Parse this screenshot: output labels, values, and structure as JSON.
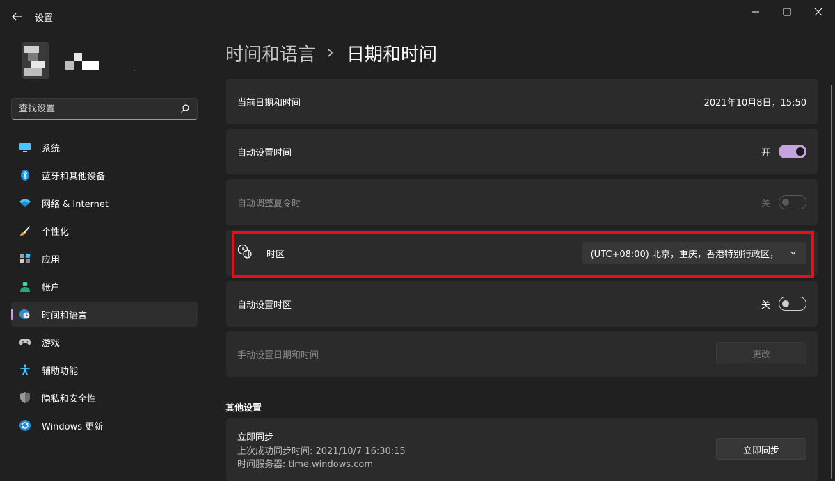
{
  "window": {
    "title": "设置"
  },
  "sidebar": {
    "search_placeholder": "查找设置",
    "items": [
      {
        "label": "系统",
        "icon": "monitor-icon"
      },
      {
        "label": "蓝牙和其他设备",
        "icon": "bluetooth-icon"
      },
      {
        "label": "网络 & Internet",
        "icon": "wifi-icon"
      },
      {
        "label": "个性化",
        "icon": "brush-icon"
      },
      {
        "label": "应用",
        "icon": "apps-icon"
      },
      {
        "label": "帐户",
        "icon": "person-icon"
      },
      {
        "label": "时间和语言",
        "icon": "globe-clock-icon",
        "active": true
      },
      {
        "label": "游戏",
        "icon": "gamepad-icon"
      },
      {
        "label": "辅助功能",
        "icon": "accessibility-icon"
      },
      {
        "label": "隐私和安全性",
        "icon": "shield-icon"
      },
      {
        "label": "Windows 更新",
        "icon": "update-icon"
      }
    ]
  },
  "breadcrumb": {
    "parent": "时间和语言",
    "current": "日期和时间"
  },
  "settings": {
    "current_datetime": {
      "label": "当前日期和时间",
      "value": "2021年10月8日，15:50"
    },
    "auto_time": {
      "label": "自动设置时间",
      "state": "开",
      "on": true
    },
    "auto_dst": {
      "label": "自动调整夏令时",
      "state": "关",
      "on": false,
      "disabled": true
    },
    "timezone": {
      "label": "时区",
      "value": "(UTC+08:00) 北京，重庆，香港特别行政区，"
    },
    "auto_timezone": {
      "label": "自动设置时区",
      "state": "关",
      "on": false
    },
    "manual_datetime": {
      "label": "手动设置日期和时间",
      "button": "更改",
      "disabled": true
    }
  },
  "other": {
    "section_title": "其他设置",
    "sync": {
      "title": "立即同步",
      "last_sync": "上次成功同步时间: 2021/10/7 16:30:15",
      "server": "时间服务器: time.windows.com",
      "button": "立即同步"
    }
  },
  "colors": {
    "accent": "#c5a3de",
    "highlight": "#e3101a",
    "background": "#202020",
    "card": "#2b2b2b"
  }
}
